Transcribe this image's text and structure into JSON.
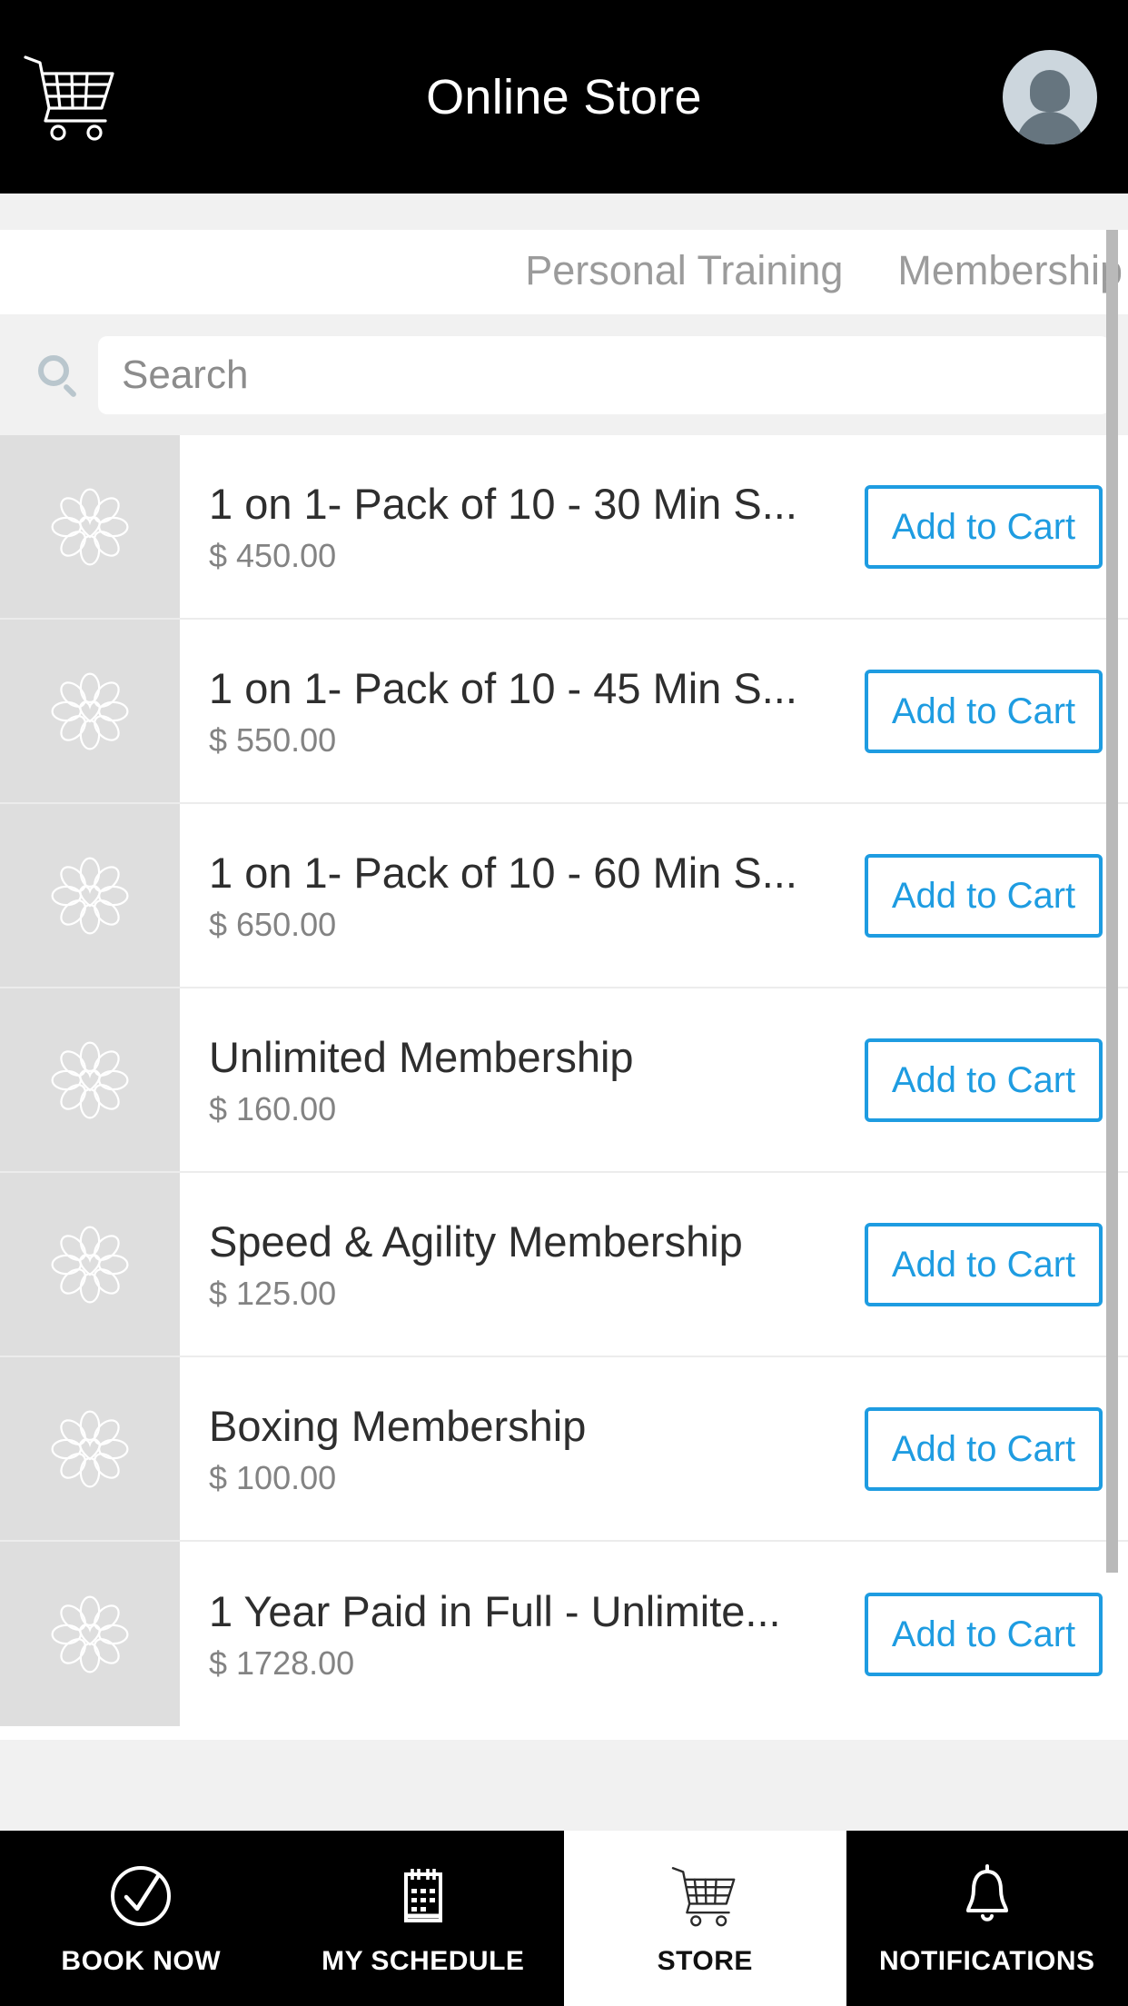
{
  "header": {
    "title": "Online Store",
    "cart_icon": "shopping-cart-icon",
    "avatar_icon": "user-avatar-icon"
  },
  "tabs": [
    {
      "label": "Personal Training",
      "selected": false
    },
    {
      "label": "Membership",
      "selected": false
    }
  ],
  "search": {
    "placeholder": "Search",
    "value": "",
    "icon": "search-icon"
  },
  "products": [
    {
      "name": "1 on 1- Pack of 10 - 30 Min S...",
      "price": "$ 450.00",
      "button": "Add to Cart"
    },
    {
      "name": "1 on 1- Pack of 10 - 45 Min S...",
      "price": "$ 550.00",
      "button": "Add to Cart"
    },
    {
      "name": "1 on 1- Pack of 10 - 60 Min S...",
      "price": "$ 650.00",
      "button": "Add to Cart"
    },
    {
      "name": "Unlimited Membership",
      "price": "$ 160.00",
      "button": "Add to Cart"
    },
    {
      "name": "Speed & Agility Membership",
      "price": "$ 125.00",
      "button": "Add to Cart"
    },
    {
      "name": "Boxing Membership",
      "price": "$ 100.00",
      "button": "Add to Cart"
    },
    {
      "name": "1 Year Paid in Full - Unlimite...",
      "price": "$ 1728.00",
      "button": "Add to Cart"
    }
  ],
  "bottom_nav": [
    {
      "label": "BOOK NOW",
      "icon": "check-circle-icon",
      "active": false
    },
    {
      "label": "MY SCHEDULE",
      "icon": "calendar-icon",
      "active": false
    },
    {
      "label": "STORE",
      "icon": "shopping-cart-icon",
      "active": true
    },
    {
      "label": "NOTIFICATIONS",
      "icon": "bell-icon",
      "active": false
    }
  ],
  "colors": {
    "accent_blue": "#1e9ce1",
    "header_bg": "#000000",
    "thumb_bg": "#dedede",
    "page_bg": "#f1f1f1"
  }
}
